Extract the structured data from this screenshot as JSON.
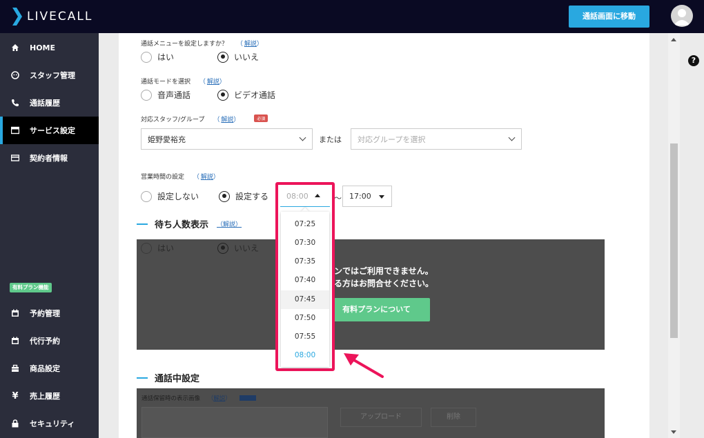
{
  "brand": {
    "name": "LIVECALL"
  },
  "topbar": {
    "call_button": "通話画面に移動"
  },
  "sidebar": {
    "items": [
      {
        "label": "HOME",
        "icon": "home-icon"
      },
      {
        "label": "スタッフ管理",
        "icon": "staff-icon"
      },
      {
        "label": "通話履歴",
        "icon": "phone-icon"
      },
      {
        "label": "サービス設定",
        "icon": "service-icon",
        "active": true
      },
      {
        "label": "契約者情報",
        "icon": "card-icon"
      }
    ],
    "plan_badge": "有料プラン機能",
    "plan_items": [
      {
        "label": "予約管理",
        "icon": "calendar-icon"
      },
      {
        "label": "代行予約",
        "icon": "calendar-icon"
      },
      {
        "label": "商品設定",
        "icon": "box-icon"
      },
      {
        "label": "売上履歴",
        "icon": "yen-icon"
      },
      {
        "label": "セキュリティ",
        "icon": "lock-icon"
      }
    ]
  },
  "form": {
    "call_menu": {
      "label": "通話メニューを設定しますか？",
      "help": "解説",
      "options": [
        "はい",
        "いいえ"
      ],
      "selected": "いいえ"
    },
    "call_mode": {
      "label": "通話モードを選択",
      "help": "解説",
      "options": [
        "音声通話",
        "ビデオ通話"
      ],
      "selected": "ビデオ通話"
    },
    "staff_group": {
      "label": "対応スタッフ/グループ",
      "help": "解説",
      "required": "必須",
      "staff_value": "姫野愛裕充",
      "or_text": "または",
      "group_placeholder": "対応グループを選択"
    },
    "hours": {
      "label": "営業時間の設定",
      "help": "解説",
      "options": [
        "設定しない",
        "設定する"
      ],
      "selected": "設定する",
      "start": "08:00",
      "tilde": "〜",
      "end": "17:00"
    }
  },
  "waiting": {
    "title": "待ち人数表示",
    "help": "解説",
    "options": [
      "はい",
      "いいえ"
    ],
    "overlay_line1": "ンではご利用できません。",
    "overlay_line2": "る方はお問合せください。",
    "plan_button": "有料プランについて"
  },
  "in_call": {
    "title": "通話中設定",
    "hold_label": "通話保留時の表示画像",
    "help": "解説",
    "upload_button": "アップロード",
    "delete_button": "削除"
  },
  "dropdown": {
    "options": [
      "07:25",
      "07:30",
      "07:35",
      "07:40",
      "07:45",
      "07:50",
      "07:55",
      "08:00"
    ],
    "highlighted": "07:45",
    "selected": "08:00"
  },
  "colors": {
    "accent": "#29a8e0",
    "callout": "#ec145a",
    "plan": "#5fc98b",
    "topbar": "#0a0a23",
    "sidebar": "#2b2d3b"
  }
}
